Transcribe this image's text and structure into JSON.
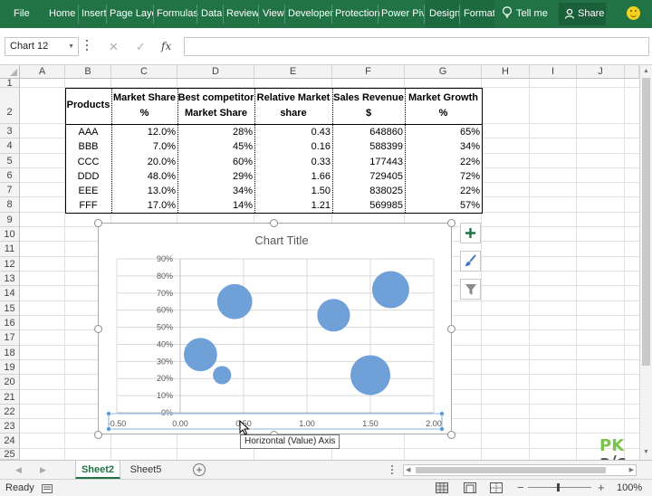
{
  "ribbon": {
    "tabs": [
      "File",
      "Home",
      "Insert",
      "Page Layo",
      "Formulas",
      "Data",
      "Review",
      "View",
      "Developer",
      "Protection",
      "Power Pivi",
      "Design",
      "Format"
    ],
    "tell_me": "Tell me",
    "share": "Share"
  },
  "formula_bar": {
    "name_box": "Chart 12",
    "fx_label": "fx",
    "formula": ""
  },
  "columns": [
    "A",
    "B",
    "C",
    "D",
    "E",
    "F",
    "G",
    "H",
    "I",
    "J"
  ],
  "rows": [
    "1",
    "2",
    "3",
    "4",
    "5",
    "6",
    "7",
    "8",
    "9",
    "10",
    "11",
    "12",
    "13",
    "14",
    "15",
    "16",
    "17",
    "18",
    "19",
    "20",
    "21",
    "22",
    "23",
    "24",
    "25"
  ],
  "table": {
    "headers": [
      [
        "Products",
        ""
      ],
      [
        "Market Share",
        "%"
      ],
      [
        "Best competitor",
        "Market Share"
      ],
      [
        "Relative Market",
        "share"
      ],
      [
        "Sales Revenue",
        "$"
      ],
      [
        "Market Growth",
        "%"
      ]
    ],
    "rows": [
      [
        "AAA",
        "12.0%",
        "28%",
        "0.43",
        "648860",
        "65%"
      ],
      [
        "BBB",
        "7.0%",
        "45%",
        "0.16",
        "588399",
        "34%"
      ],
      [
        "CCC",
        "20.0%",
        "60%",
        "0.33",
        "177443",
        "22%"
      ],
      [
        "DDD",
        "48.0%",
        "29%",
        "1.66",
        "729405",
        "72%"
      ],
      [
        "EEE",
        "13.0%",
        "34%",
        "1.50",
        "838025",
        "22%"
      ],
      [
        "FFF",
        "17.0%",
        "14%",
        "1.21",
        "569985",
        "57%"
      ]
    ]
  },
  "chart_data": {
    "type": "bubble",
    "title": "Chart Title",
    "xlim": [
      -0.5,
      2.0
    ],
    "ylim": [
      0,
      0.9
    ],
    "x_ticks": [
      "-0.50",
      "0.00",
      "0.50",
      "1.00",
      "1.50",
      "2.00"
    ],
    "y_ticks": [
      "0%",
      "10%",
      "20%",
      "30%",
      "40%",
      "50%",
      "60%",
      "70%",
      "80%",
      "90%"
    ],
    "grid": true,
    "legend": "none",
    "bubble_color": "#70a0d8",
    "points": [
      {
        "x": 0.43,
        "y": 0.65,
        "size": 648860
      },
      {
        "x": 0.16,
        "y": 0.34,
        "size": 588399
      },
      {
        "x": 0.33,
        "y": 0.22,
        "size": 177443
      },
      {
        "x": 1.66,
        "y": 0.72,
        "size": 729405
      },
      {
        "x": 1.5,
        "y": 0.22,
        "size": 838025
      },
      {
        "x": 1.21,
        "y": 0.57,
        "size": 569985
      }
    ]
  },
  "tooltip": "Horizontal (Value) Axis",
  "sheets": [
    {
      "label": "Sheet2",
      "active": true
    },
    {
      "label": "Sheet5",
      "active": false
    }
  ],
  "status": {
    "ready": "Ready",
    "zoom": "100%"
  },
  "watermark": {
    "line1": "PK",
    "line2": "a/c"
  },
  "colors": {
    "ribbon": "#217346",
    "accent_green": "#217346",
    "bubble": "#70a0d8"
  }
}
